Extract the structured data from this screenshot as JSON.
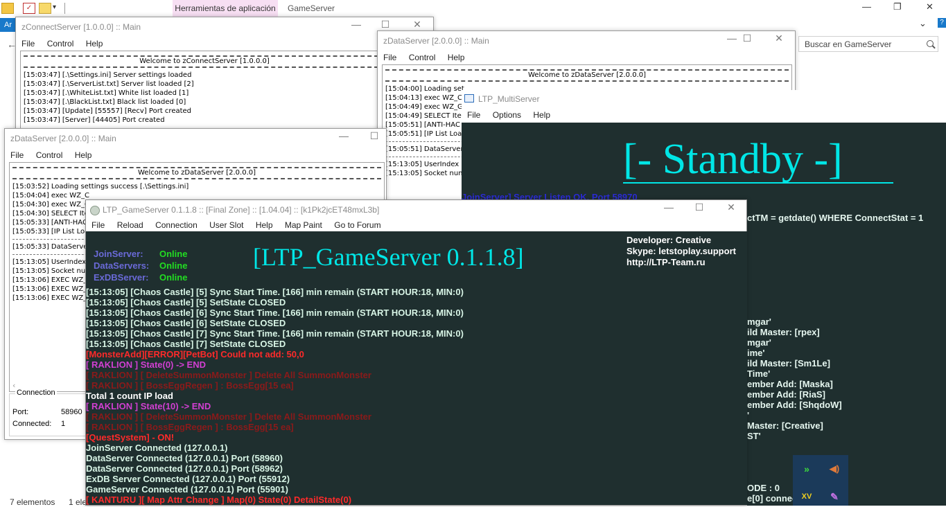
{
  "explorer": {
    "ribbon_tab": "Herramientas de aplicación",
    "ribbon_title": "GameServer",
    "blue_tab": "Ar",
    "search_placeholder": "Buscar en GameServer",
    "status_items": "7 elementos",
    "status_selected": "1 ele",
    "minimize": "—",
    "maximize": "❐",
    "close": "✕",
    "chevron": "⌄"
  },
  "zconnect": {
    "title": "zConnectServer [1.0.0.0] :: Main",
    "menu": [
      "File",
      "Control",
      "Help"
    ],
    "welcome": "Welcome to zConnectServer [1.0.0.0]",
    "lines": [
      "[15:03:47] [.\\Settings.ini] Server settings loaded",
      "[15:03:47] [.\\ServerList.txt] Server list loaded [2]",
      "[15:03:47] [.\\WhiteList.txt] White list loaded [1]",
      "[15:03:47] [.\\BlackList.txt] Black list loaded [0]",
      "[15:03:47] [Update] [55557] [Recv] Port created",
      "[15:03:47] [Server] [44405] Port created"
    ]
  },
  "zdata1": {
    "title": "zDataServer [2.0.0.0] :: Main",
    "menu": [
      "File",
      "Control",
      "Help"
    ],
    "welcome": "Welcome to zDataServer [2.0.0.0]",
    "lines1": [
      "[15:03:52] Loading settings success [.\\Settings.ini]",
      "[15:04:04] exec WZ_C",
      "[15:04:30] exec WZ_C",
      "[15:04:30] SELECT Ite",
      "[15:05:33] [ANTI-HAC",
      "[15:05:33] [IP List Loa"
    ],
    "line_ds": "[15:05:33] DataServe",
    "lines2": [
      "[15:13:05] UserIndex",
      "[15:13:05] Socket num",
      "[15:13:06] EXEC WZ_",
      "[15:13:06] EXEC WZ_",
      "[15:13:06] EXEC WZ_"
    ],
    "connection_label": "Connection",
    "port_label": "Port:",
    "port_value": "58960",
    "connected_label": "Connected:",
    "connected_value": "1",
    "scroll_left": "‹"
  },
  "zdata2": {
    "title": "zDataServer [2.0.0.0] :: Main",
    "menu": [
      "File",
      "Control",
      "Help"
    ],
    "welcome": "Welcome to zDataServer [2.0.0.0]",
    "lines1": [
      "[15:04:00] Loading set",
      "[15:04:13] exec WZ_C",
      "[15:04:49] exec WZ_G",
      "[15:04:49] SELECT Ite",
      "[15:05:51] [ANTI-HAC",
      "[15:05:51] [IP List Loa"
    ],
    "line_ds": "[15:05:51] DataServer",
    "lines2": [
      "[15:13:05] UserIndex",
      "[15:13:05] Socket num"
    ]
  },
  "multiserver": {
    "title": "LTP_MultiServer",
    "menu": [
      "File",
      "Options",
      "Help"
    ],
    "standby": "[-  Standby  -]",
    "join_line": "JoinServer] Server Listen OK, Port 58970",
    "connect_line": "ctTM = getdate() WHERE ConnectStat = 1",
    "right_lines": [
      "mgar'",
      "ild Master: [rpex]",
      "mgar'",
      "ime'",
      "ild Master: [Sm1Le]",
      "Time'",
      "ember Add: [Maska]",
      "ember Add: [RiaS]",
      "ember Add: [ShqdoW]",
      "'",
      " Master: [Creative]",
      "ST'"
    ],
    "mode_line": "ODE : 0",
    "conn_line": "e[0] connec"
  },
  "gameserver": {
    "title": "LTP_GameServer 0.1.1.8 :: [Final Zone] :: [1.04.04] :: [k1Pk2jcET48mxL3b]",
    "menu": [
      "File",
      "Reload",
      "Connection",
      "User Slot",
      "Help",
      "Map Paint",
      "Go to Forum"
    ],
    "big_title": "[LTP_GameServer 0.1.1.8]",
    "status": [
      {
        "key": "JoinServer:",
        "value": "Online"
      },
      {
        "key": "DataServers:",
        "value": "Online"
      },
      {
        "key": "ExDBServer:",
        "value": "Online"
      }
    ],
    "developer": [
      "Developer: Creative",
      "Skype: letstoplay.support",
      "http://LTP-Team.ru"
    ],
    "log": [
      {
        "text": "[15:13:05] [Chaos Castle] [5] Sync Start Time. [166] min remain (START HOUR:18, MIN:0)",
        "color": "#d8f5e6"
      },
      {
        "text": "[15:13:05] [Chaos Castle] [5] SetState CLOSED",
        "color": "#d8f5e6"
      },
      {
        "text": "[15:13:05] [Chaos Castle] [6] Sync Start Time. [166] min remain (START HOUR:18, MIN:0)",
        "color": "#d8f5e6"
      },
      {
        "text": "[15:13:05] [Chaos Castle] [6] SetState CLOSED",
        "color": "#d8f5e6"
      },
      {
        "text": "[15:13:05] [Chaos Castle] [7] Sync Start Time. [166] min remain (START HOUR:18, MIN:0)",
        "color": "#d8f5e6"
      },
      {
        "text": "[15:13:05] [Chaos Castle] [7] SetState CLOSED",
        "color": "#d8f5e6"
      },
      {
        "text": "[MonsterAdd][ERROR][PetBot] Could not add: 50,0",
        "color": "#ff2a2a"
      },
      {
        "text": "[ RAKLION ] State(0) -> END",
        "color": "#d23fd2"
      },
      {
        "text": "[ RAKLION ] [ DeleteSummonMonster ] Delete All SummonMonster",
        "color": "#8a1a1a"
      },
      {
        "text": "[ RAKLION ] [ BossEggRegen ] : BossEgg[15 ea]",
        "color": "#8a1a1a"
      },
      {
        "text": "Total 1 count IP load",
        "color": "#ffffff"
      },
      {
        "text": "[ RAKLION ] State(10) -> END",
        "color": "#d23fd2"
      },
      {
        "text": "[ RAKLION ] [ DeleteSummonMonster ] Delete All SummonMonster",
        "color": "#8a1a1a"
      },
      {
        "text": "[ RAKLION ] [ BossEggRegen ] : BossEgg[15 ea]",
        "color": "#8a1a1a"
      },
      {
        "text": "[QuestSystem] - ON!",
        "color": "#ff2a2a"
      },
      {
        "text": "JoinServer Connected (127.0.0.1)",
        "color": "#d8f5e6"
      },
      {
        "text": "DataServer Connected (127.0.0.1) Port (58960)",
        "color": "#d8f5e6"
      },
      {
        "text": "DataServer Connected (127.0.0.1) Port (58962)",
        "color": "#d8f5e6"
      },
      {
        "text": "ExDB Server Connected (127.0.0.1) Port (55912)",
        "color": "#d8f5e6"
      },
      {
        "text": "GameServer Connected (127.0.0.1) Port (55901)",
        "color": "#d8f5e6"
      },
      {
        "text": "[ KANTURU ][ Map Attr Change ] Map(0) State(0) DetailState(0)",
        "color": "#ff2a2a"
      }
    ]
  },
  "tray": {
    "icons": [
      "forward-icon",
      "speaker-icon",
      "xv-icon",
      "feather-icon"
    ],
    "xv_label": "XV"
  }
}
